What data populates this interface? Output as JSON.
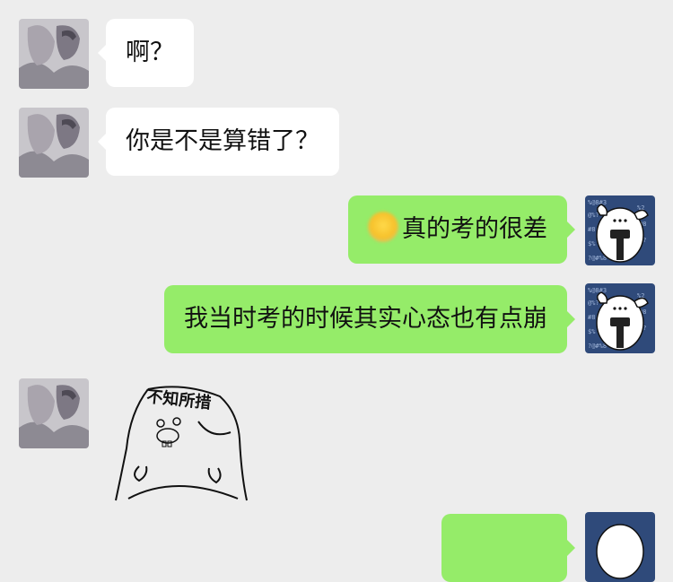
{
  "messages": [
    {
      "side": "in",
      "text": "啊？"
    },
    {
      "side": "in",
      "text": "你是不是算错了？"
    },
    {
      "side": "out",
      "emoji": "crying-laughing",
      "text": "真的考的很差"
    },
    {
      "side": "out",
      "text": "我当时考的时候其实心态也有点崩"
    },
    {
      "side": "in",
      "sticker_text": "不知所措"
    },
    {
      "side": "out",
      "text": ""
    }
  ],
  "colors": {
    "background": "#ededed",
    "incoming_bubble": "#ffffff",
    "outgoing_bubble": "#95ec69"
  }
}
